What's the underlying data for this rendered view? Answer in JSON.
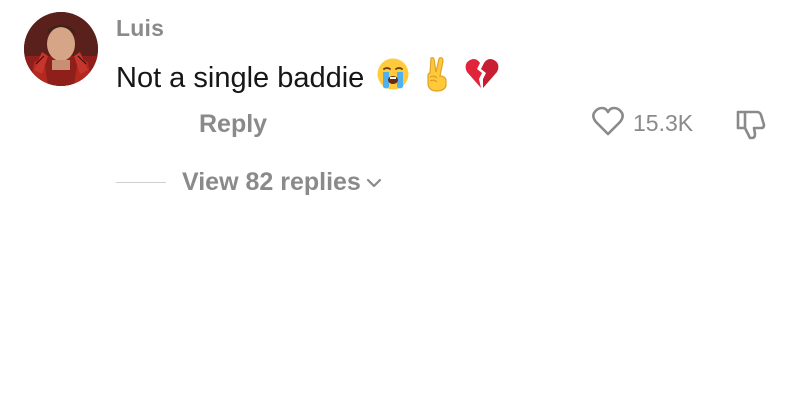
{
  "comment": {
    "username": "Luis",
    "text": "Not a single baddie",
    "emojis": [
      "loudly-crying-face",
      "victory-hand",
      "broken-heart"
    ]
  },
  "actions": {
    "reply_label": "Reply",
    "like_count": "15.3K",
    "view_replies_label": "View 82 replies"
  },
  "colors": {
    "primary_text": "#161616",
    "secondary_text": "#8a8a8a",
    "divider": "#cfcfcf",
    "broken_heart": "#e0243a"
  }
}
